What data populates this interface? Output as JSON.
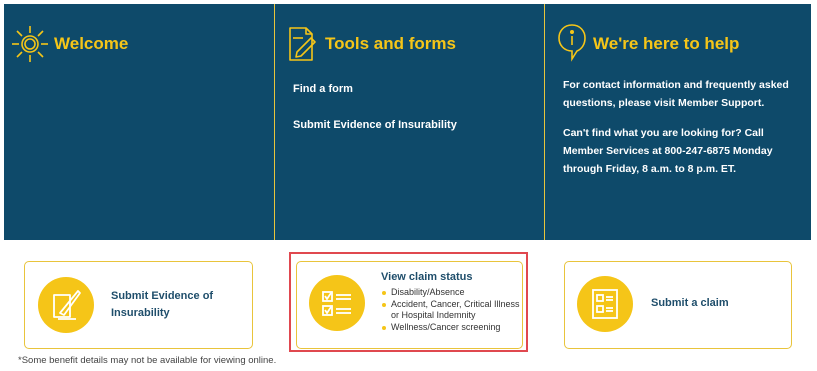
{
  "welcome": {
    "title": "Welcome",
    "icon": "sun-icon"
  },
  "tools": {
    "title": "Tools and forms",
    "icon": "document-pencil-icon",
    "links": [
      "Find a form",
      "Submit Evidence of Insurability"
    ]
  },
  "help": {
    "title": "We're here to help",
    "icon": "info-icon",
    "paragraph1": "For contact information and frequently asked questions, please visit Member Support.",
    "paragraph2": "Can't find what you are looking for? Call Member Services at 800-247-6875 Monday through Friday, 8 a.m. to 8 p.m. ET."
  },
  "cards": {
    "evidence": {
      "label": "Submit Evidence of Insurability",
      "icon": "quill-document-icon"
    },
    "claim_status": {
      "title": "View claim status",
      "icon": "checklist-icon",
      "items": [
        "Disability/Absence",
        "Accident, Cancer, Critical Illness or Hospital Indemnity",
        "Wellness/Cancer screening"
      ]
    },
    "submit_claim": {
      "label": "Submit a claim",
      "icon": "claim-form-icon"
    }
  },
  "footnote": "*Some benefit details may not be available for viewing online.",
  "colors": {
    "panel_bg": "#0e4a6a",
    "accent": "#f5c518",
    "highlight": "#e0484f"
  }
}
